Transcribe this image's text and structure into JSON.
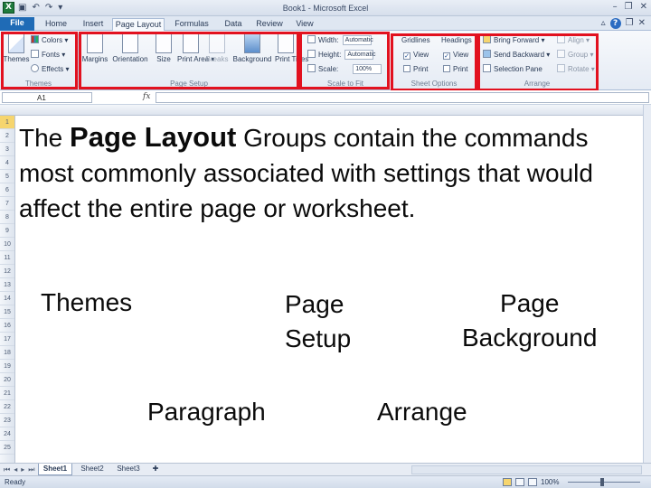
{
  "window": {
    "title": "Book1 - Microsoft Excel",
    "app_icon_glyph": "X"
  },
  "tabs": [
    {
      "label": "File"
    },
    {
      "label": "Home"
    },
    {
      "label": "Insert"
    },
    {
      "label": "Page Layout"
    },
    {
      "label": "Formulas"
    },
    {
      "label": "Data"
    },
    {
      "label": "Review"
    },
    {
      "label": "View"
    }
  ],
  "ribbon": {
    "themes": {
      "themes_label": "Themes",
      "colors": "Colors ▾",
      "fonts": "Fonts ▾",
      "effects": "Effects ▾",
      "group_label": "Themes"
    },
    "page_setup": {
      "margins": "Margins",
      "orientation": "Orientation",
      "size": "Size",
      "print_area": "Print Area ▾",
      "breaks": "Breaks",
      "background": "Background",
      "print_titles": "Print Titles",
      "group_label": "Page Setup"
    },
    "scale_to_fit": {
      "width_label": "Width:",
      "width_value": "Automatic",
      "height_label": "Height:",
      "height_value": "Automatic",
      "scale_label": "Scale:",
      "scale_value": "100%",
      "group_label": "Scale to Fit"
    },
    "sheet_options": {
      "gridlines": "Gridlines",
      "headings": "Headings",
      "view1": "View",
      "view2": "View",
      "print1": "Print",
      "print2": "Print",
      "group_label": "Sheet Options"
    },
    "arrange": {
      "bring_forward": "Bring Forward ▾",
      "send_backward": "Send Backward ▾",
      "selection_pane": "Selection Pane",
      "align": "Align ▾",
      "group": "Group ▾",
      "rotate": "Rotate ▾",
      "group_label": "Arrange"
    }
  },
  "formula_bar": {
    "name_box": "A1",
    "fx": "fx"
  },
  "row_numbers": [
    "1",
    "2",
    "3",
    "4",
    "5",
    "6",
    "7",
    "8",
    "9",
    "10",
    "11",
    "12",
    "13",
    "14",
    "15",
    "16",
    "17",
    "18",
    "19",
    "20",
    "21",
    "22",
    "23",
    "24",
    "25"
  ],
  "slide": {
    "intro_before": "The ",
    "intro_emphasis": "Page Layout",
    "intro_after": " Groups contain the commands most commonly associated with settings that would affect the entire page or worksheet.",
    "themes": "Themes",
    "page_setup_line1": "Page",
    "page_setup_line2": "Setup",
    "page_background_line1": "Page",
    "page_background_line2": "Background",
    "paragraph": "Paragraph",
    "arrange": "Arrange"
  },
  "sheets": [
    {
      "label": "Sheet1"
    },
    {
      "label": "Sheet2"
    },
    {
      "label": "Sheet3"
    }
  ],
  "status": {
    "ready": "Ready",
    "zoom": "100%"
  },
  "colors": {
    "highlight": "#e2111f",
    "file_tab": "#1f6bb6",
    "app_green": "#1f7a3d"
  }
}
